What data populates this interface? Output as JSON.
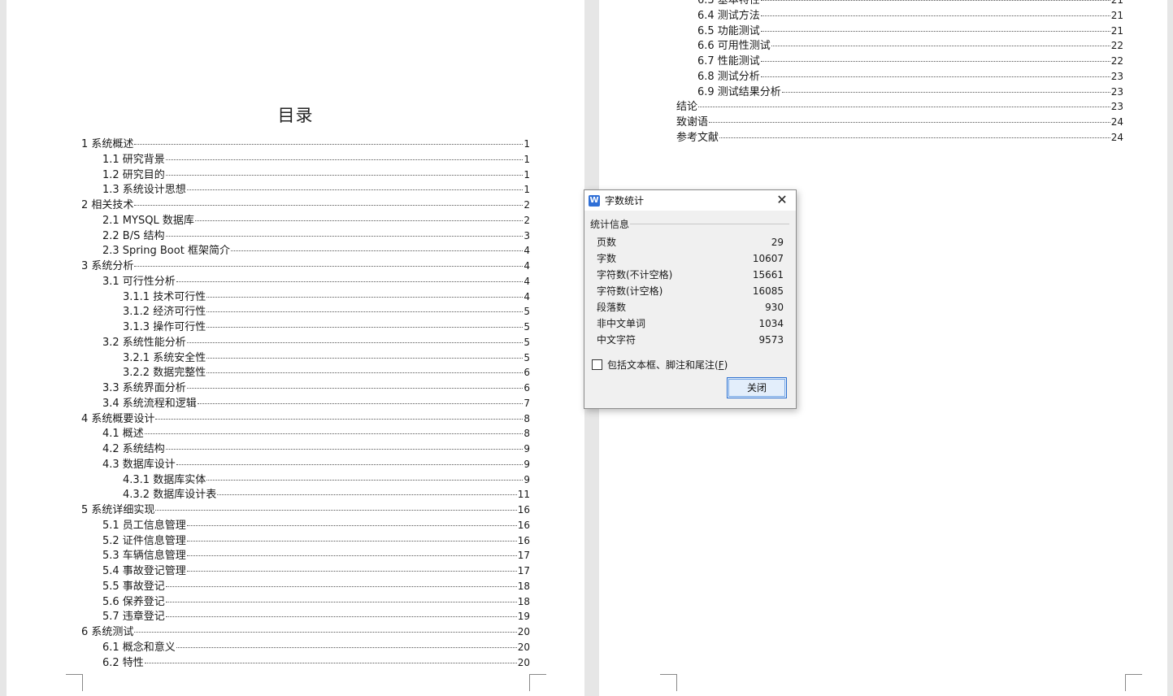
{
  "left_page": {
    "title": "目录",
    "entries": [
      {
        "label": "1 系统概述",
        "page": "1",
        "level": 1
      },
      {
        "label": "1.1  研究背景",
        "page": "1",
        "level": 2
      },
      {
        "label": "1.2 研究目的",
        "page": "1",
        "level": 2
      },
      {
        "label": "1.3 系统设计思想",
        "page": "1",
        "level": 2
      },
      {
        "label": "2 相关技术",
        "page": "2",
        "level": 1
      },
      {
        "label": "2.1 MYSQL 数据库",
        "page": "2",
        "level": 2
      },
      {
        "label": "2.2 B/S 结构",
        "page": "3",
        "level": 2
      },
      {
        "label": "2.3 Spring Boot 框架简介",
        "page": "4",
        "level": 2
      },
      {
        "label": "3 系统分析",
        "page": "4",
        "level": 1
      },
      {
        "label": "3.1 可行性分析",
        "page": "4",
        "level": 2
      },
      {
        "label": "3.1.1 技术可行性",
        "page": "4",
        "level": 3
      },
      {
        "label": "3.1.2 经济可行性",
        "page": "5",
        "level": 3
      },
      {
        "label": "3.1.3 操作可行性",
        "page": "5",
        "level": 3
      },
      {
        "label": "3.2 系统性能分析",
        "page": "5",
        "level": 2
      },
      {
        "label": "3.2.1  系统安全性",
        "page": "5",
        "level": 3
      },
      {
        "label": "3.2.2  数据完整性",
        "page": "6",
        "level": 3
      },
      {
        "label": "3.3 系统界面分析",
        "page": "6",
        "level": 2
      },
      {
        "label": "3.4 系统流程和逻辑",
        "page": "7",
        "level": 2
      },
      {
        "label": "4 系统概要设计",
        "page": "8",
        "level": 1
      },
      {
        "label": "4.1 概述",
        "page": "8",
        "level": 2
      },
      {
        "label": "4.2 系统结构",
        "page": "9",
        "level": 2
      },
      {
        "label": "4.3 数据库设计",
        "page": "9",
        "level": 2
      },
      {
        "label": "4.3.1 数据库实体",
        "page": "9",
        "level": 3
      },
      {
        "label": "4.3.2 数据库设计表",
        "page": "11",
        "level": 3
      },
      {
        "label": "5 系统详细实现",
        "page": "16",
        "level": 1
      },
      {
        "label": "5.1  员工信息管理",
        "page": "16",
        "level": 2
      },
      {
        "label": "5.2  证件信息管理",
        "page": "16",
        "level": 2
      },
      {
        "label": "5.3  车辆信息管理",
        "page": "17",
        "level": 2
      },
      {
        "label": "5.4  事故登记管理",
        "page": "17",
        "level": 2
      },
      {
        "label": "5.5  事故登记",
        "page": "18",
        "level": 2
      },
      {
        "label": "5.6  保养登记",
        "page": "18",
        "level": 2
      },
      {
        "label": "5.7  违章登记",
        "page": "19",
        "level": 2
      },
      {
        "label": "6 系统测试",
        "page": "20",
        "level": 1
      },
      {
        "label": "6.1 概念和意义",
        "page": "20",
        "level": 2
      },
      {
        "label": "6.2 特性",
        "page": "20",
        "level": 2
      }
    ]
  },
  "right_page": {
    "entries": [
      {
        "label": "6.3 基本特性",
        "page": "21",
        "level": 2
      },
      {
        "label": "6.4 测试方法",
        "page": "21",
        "level": 2
      },
      {
        "label": "6.5  功能测试",
        "page": "21",
        "level": 2
      },
      {
        "label": "6.6 可用性测试",
        "page": "22",
        "level": 2
      },
      {
        "label": "6.7 性能测试",
        "page": "22",
        "level": 2
      },
      {
        "label": "6.8 测试分析",
        "page": "23",
        "level": 2
      },
      {
        "label": "6.9 测试结果分析",
        "page": "23",
        "level": 2
      },
      {
        "label": "结论",
        "page": "23",
        "level": 1
      },
      {
        "label": "致谢语",
        "page": "24",
        "level": 1
      },
      {
        "label": "参考文献",
        "page": "24",
        "level": 1
      }
    ]
  },
  "dialog": {
    "app_icon": "W",
    "title": "字数统计",
    "group_label": "统计信息",
    "stats": [
      {
        "label": "页数",
        "value": "29"
      },
      {
        "label": "字数",
        "value": "10607"
      },
      {
        "label": "字符数(不计空格)",
        "value": "15661"
      },
      {
        "label": "字符数(计空格)",
        "value": "16085"
      },
      {
        "label": "段落数",
        "value": "930"
      },
      {
        "label": "非中文单词",
        "value": "1034"
      },
      {
        "label": "中文字符",
        "value": "9573"
      }
    ],
    "checkbox_label": "包括文本框、脚注和尾注(",
    "checkbox_hotkey": "F",
    "checkbox_suffix": ")",
    "checkbox_checked": false,
    "close_button": "关闭"
  }
}
